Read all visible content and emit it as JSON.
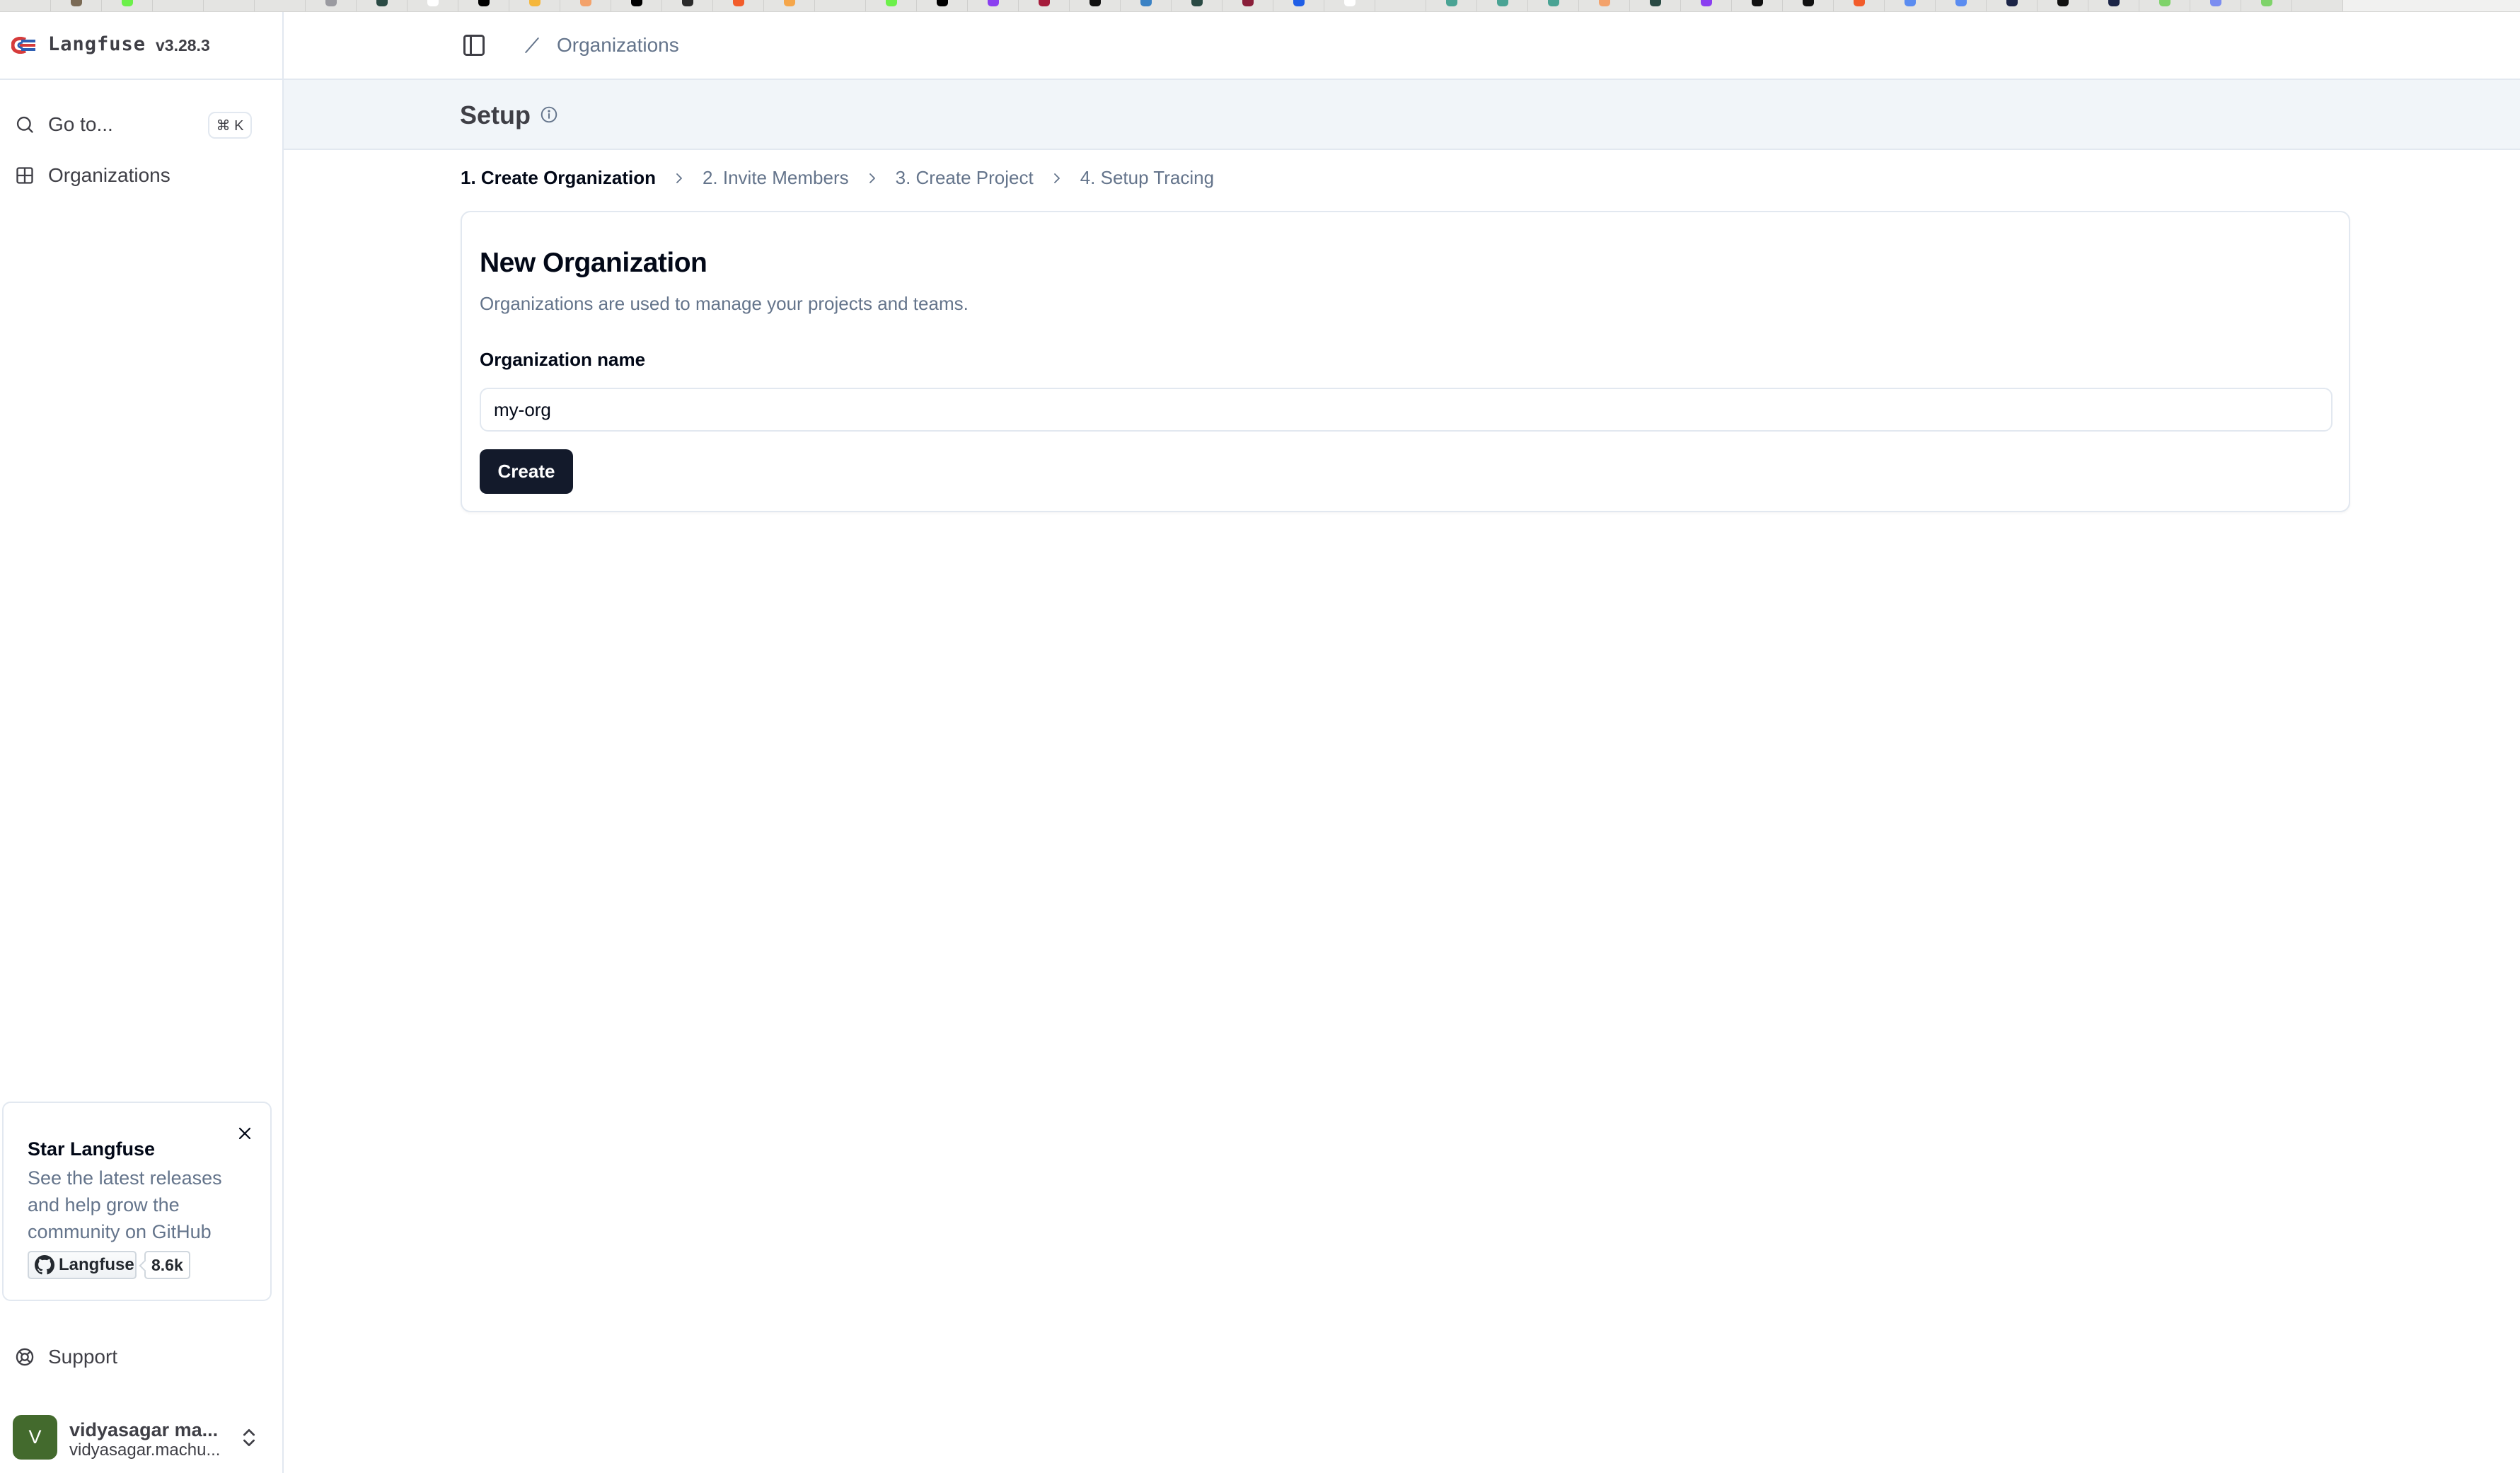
{
  "browser": {
    "tab_favicon_colors": [
      "#e4e4e2",
      "#7a6a55",
      "#6cf04a",
      "#e4e4e2",
      "#e4e4e2",
      "#e4e4e2",
      "#9a9aa0",
      "#2a4a44",
      "#ffffff",
      "#000000",
      "#f5b73b",
      "#f3a26b",
      "#000000",
      "#2b2b2b",
      "#f25c2a",
      "#f5a64a",
      "#e4e4e2",
      "#6cf04a",
      "#000000",
      "#8a3ff0",
      "#a51c3b",
      "#111111",
      "#3b82c4",
      "#2a4a44",
      "#8a1f3a",
      "#1f5ee6",
      "#ffffff",
      "#e4e4e2",
      "#4aa394",
      "#4aa394",
      "#4aa394",
      "#f3a26b",
      "#2a4a44",
      "#8a3ff0",
      "#111111",
      "#111111",
      "#f25c2a",
      "#5b8cf0",
      "#5b8cf0",
      "#1c2547",
      "#111111",
      "#1c2547",
      "#7fd36a",
      "#7b8df0",
      "#7fd36a",
      "#e4e4e2"
    ]
  },
  "sidebar": {
    "brand_name": "Langfuse",
    "version": "v3.28.3",
    "goto_label": "Go to...",
    "goto_shortcut": "⌘ K",
    "items": [
      {
        "label": "Organizations",
        "icon": "grid-icon"
      }
    ],
    "star_card": {
      "title": "Star Langfuse",
      "description": "See the latest releases and help grow the community on GitHub",
      "github_button_label": "Langfuse",
      "star_count": "8.6k"
    },
    "support_label": "Support",
    "user": {
      "initial": "V",
      "name": "vidyasagar ma...",
      "email": "vidyasagar.machu...",
      "avatar_color": "#436a2d"
    }
  },
  "header": {
    "breadcrumb": [
      "Organizations"
    ]
  },
  "page": {
    "title": "Setup",
    "steps": [
      {
        "label": "1. Create Organization",
        "active": true
      },
      {
        "label": "2. Invite Members",
        "active": false
      },
      {
        "label": "3. Create Project",
        "active": false
      },
      {
        "label": "4. Setup Tracing",
        "active": false
      }
    ],
    "card": {
      "title": "New Organization",
      "description": "Organizations are used to manage your projects and teams.",
      "field_label": "Organization name",
      "field_value": "my-org",
      "submit_label": "Create"
    }
  },
  "colors": {
    "primary_button": "#131a2b",
    "muted_text": "#64748b",
    "border": "#e2e8f0",
    "band_bg": "#f1f5f9"
  }
}
